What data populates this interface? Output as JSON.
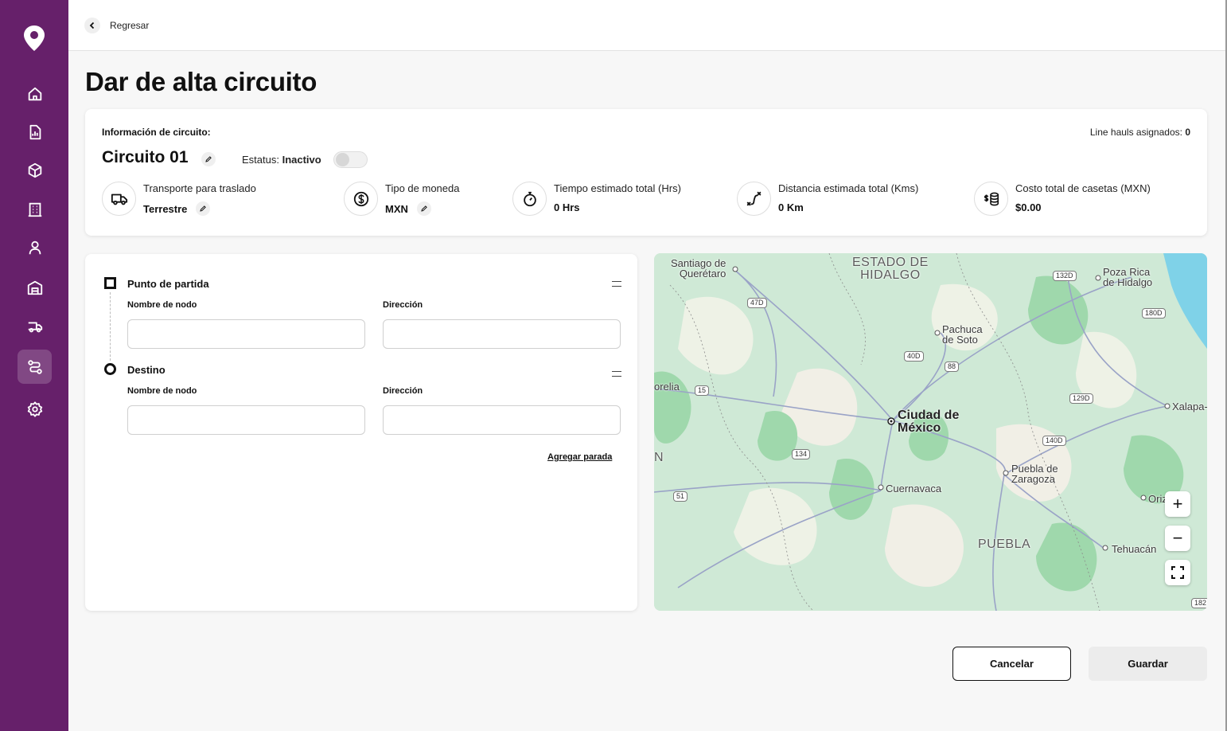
{
  "colors": {
    "sidebar": "#66206a",
    "map_land": "#cfe9d6",
    "map_water": "#7fd2e8"
  },
  "sidebar": {
    "items": [
      {
        "icon": "home-icon"
      },
      {
        "icon": "report-icon"
      },
      {
        "icon": "package-icon"
      },
      {
        "icon": "building-icon"
      },
      {
        "icon": "user-icon"
      },
      {
        "icon": "warehouse-icon"
      },
      {
        "icon": "truck-fast-icon"
      },
      {
        "icon": "route-icon",
        "active": true
      },
      {
        "icon": "gear-icon"
      }
    ]
  },
  "header": {
    "back_label": "Regresar"
  },
  "page": {
    "title": "Dar de alta circuito"
  },
  "info": {
    "heading": "Información de circuito:",
    "linehauls_label": "Line hauls asignados:",
    "linehauls_value": "0",
    "circuit_name": "Circuito 01",
    "status_label": "Estatus:",
    "status_value": "Inactivo",
    "stats": [
      {
        "icon": "truck-icon",
        "label": "Transporte para traslado",
        "value": "Terrestre"
      },
      {
        "icon": "currency-icon",
        "label": "Tipo de moneda",
        "value": "MXN"
      },
      {
        "icon": "stopwatch-icon",
        "label": "Tiempo estimado total (Hrs)",
        "value": "0 Hrs"
      },
      {
        "icon": "route-distance-icon",
        "label": "Distancia estimada total (Kms)",
        "value": "0 Km"
      },
      {
        "icon": "coins-icon",
        "label": "Costo total de casetas (MXN)",
        "value": "$0.00"
      }
    ]
  },
  "route": {
    "origin": {
      "title": "Punto de partida",
      "node_label": "Nombre de nodo",
      "address_label": "Dirección",
      "node_value": "",
      "address_value": ""
    },
    "destination": {
      "title": "Destino",
      "node_label": "Nombre de nodo",
      "address_label": "Dirección",
      "node_value": "",
      "address_value": ""
    },
    "add_stop": "Agregar parada"
  },
  "map": {
    "labels": {
      "queretaro": "Santiago de\nQuerétaro",
      "hidalgo": "ESTADO DE\nHIDALGO",
      "pozarica": "Poza Rica\nde Hidalgo",
      "pachuca": "Pachuca\nde Soto",
      "morelia": "orelia",
      "cdmx": "Ciudad de\nMéxico",
      "xalapa": "Xalapa-",
      "puebla_city": "Puebla de\nZaragoza",
      "cuernavaca": "Cuernavaca",
      "orizaba": "Oriz",
      "puebla": "PUEBLA",
      "tehuacan": "Tehuacán",
      "n_edge": "N"
    },
    "highways": [
      "47D",
      "132D",
      "180D",
      "40D",
      "88",
      "15",
      "129D",
      "140D",
      "134",
      "51",
      "182"
    ],
    "controls": {
      "zoom_in": "+",
      "zoom_out": "−"
    }
  },
  "footer": {
    "cancel": "Cancelar",
    "save": "Guardar"
  }
}
